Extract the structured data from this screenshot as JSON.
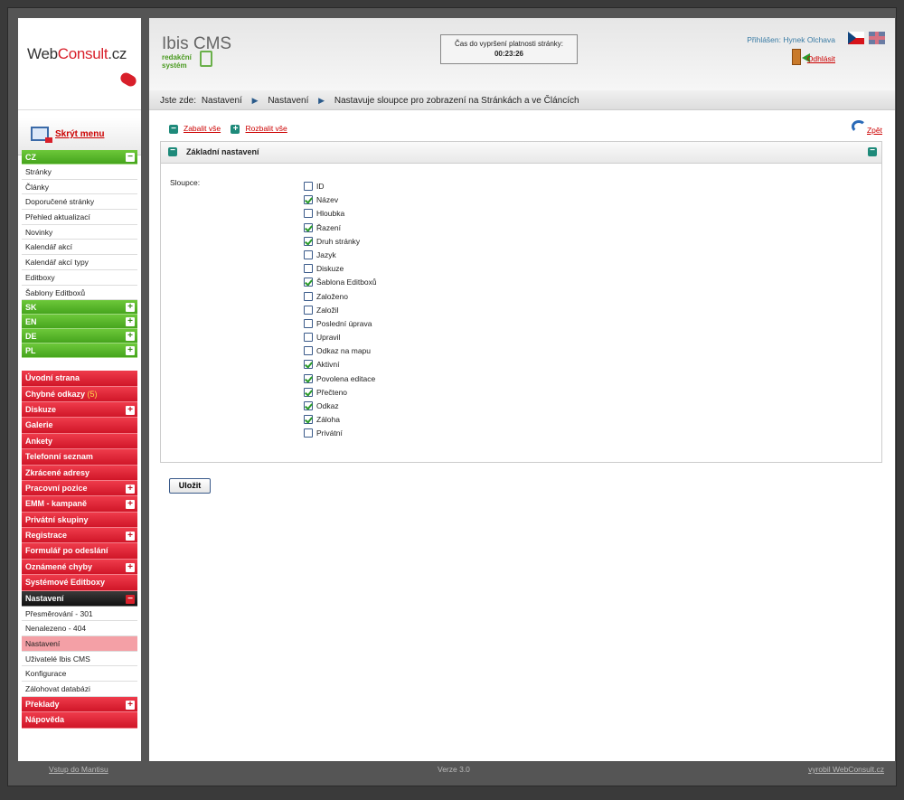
{
  "logo": {
    "brand_a": "Web",
    "brand_b": "Consult",
    "brand_c": ".cz"
  },
  "sidebar": {
    "hide_menu": "Skrýt menu",
    "cz": {
      "label": "CZ",
      "items": [
        "Stránky",
        "Články",
        "Doporučené stránky",
        "Přehled aktualizací",
        "Novinky",
        "Kalendář akcí",
        "Kalendář akcí typy",
        "Editboxy",
        "Šablony Editboxů"
      ]
    },
    "langs": [
      "SK",
      "EN",
      "DE",
      "PL"
    ],
    "red_groups": [
      {
        "label": "Úvodní strana",
        "tog": ""
      },
      {
        "label": "Chybné odkazy",
        "count": "(5)",
        "tog": ""
      },
      {
        "label": "Diskuze",
        "tog": "+"
      },
      {
        "label": "Galerie",
        "tog": ""
      },
      {
        "label": "Ankety",
        "tog": ""
      },
      {
        "label": "Telefonní seznam",
        "tog": ""
      },
      {
        "label": "Zkrácené adresy",
        "tog": ""
      },
      {
        "label": "Pracovní pozice",
        "tog": "+"
      },
      {
        "label": "EMM - kampaně",
        "tog": "+"
      },
      {
        "label": "Privátní skupiny",
        "tog": ""
      },
      {
        "label": "Registrace",
        "tog": "+"
      },
      {
        "label": "Formulář po odeslání",
        "tog": ""
      },
      {
        "label": "Oznámené chyby",
        "tog": "+"
      },
      {
        "label": "Systémové Editboxy",
        "tog": ""
      }
    ],
    "settings": {
      "label": "Nastavení",
      "items": [
        "Přesměrování - 301",
        "Nenalezeno - 404",
        "Nastavení",
        "Uživatelé Ibis CMS",
        "Konfigurace",
        "Zálohovat databázi"
      ],
      "selected": 2
    },
    "bottom": [
      {
        "label": "Překlady",
        "tog": "+"
      },
      {
        "label": "Nápověda",
        "tog": ""
      }
    ]
  },
  "header": {
    "app_title": "Ibis CMS",
    "app_sub1": "redakční",
    "app_sub2": "systém",
    "timer_label": "Čas do vypršení platnosti stránky:",
    "timer_value": "00:23:26",
    "logged_in": "Přihlášen: Hynek Olchava",
    "logout": "Odhlásit"
  },
  "breadcrumb": {
    "prefix": "Jste zde:",
    "items": [
      "Nastavení",
      "Nastavení",
      "Nastavuje sloupce pro zobrazení na Stránkách a ve Článcích"
    ]
  },
  "toolbar": {
    "collapse": "Zabalit vše",
    "expand": "Rozbalit vše",
    "back": "Zpět"
  },
  "panel": {
    "title": "Základní nastavení",
    "label": "Sloupce:",
    "columns": [
      {
        "name": "ID",
        "checked": false
      },
      {
        "name": "Název",
        "checked": true
      },
      {
        "name": "Hloubka",
        "checked": false
      },
      {
        "name": "Řazení",
        "checked": true
      },
      {
        "name": "Druh stránky",
        "checked": true
      },
      {
        "name": "Jazyk",
        "checked": false
      },
      {
        "name": "Diskuze",
        "checked": false
      },
      {
        "name": "Šablona Editboxů",
        "checked": true
      },
      {
        "name": "Založeno",
        "checked": false
      },
      {
        "name": "Založil",
        "checked": false
      },
      {
        "name": "Poslední úprava",
        "checked": false
      },
      {
        "name": "Upravil",
        "checked": false
      },
      {
        "name": "Odkaz na mapu",
        "checked": false
      },
      {
        "name": "Aktivní",
        "checked": true
      },
      {
        "name": "Povolena editace",
        "checked": true
      },
      {
        "name": "Přečteno",
        "checked": true
      },
      {
        "name": "Odkaz",
        "checked": true
      },
      {
        "name": "Záloha",
        "checked": true
      },
      {
        "name": "Privátní",
        "checked": false
      }
    ]
  },
  "save_label": "Uložit",
  "footer": {
    "left": "Vstup do Mantisu",
    "center": "Verze 3.0",
    "right": "vyrobil WebConsult.cz"
  }
}
